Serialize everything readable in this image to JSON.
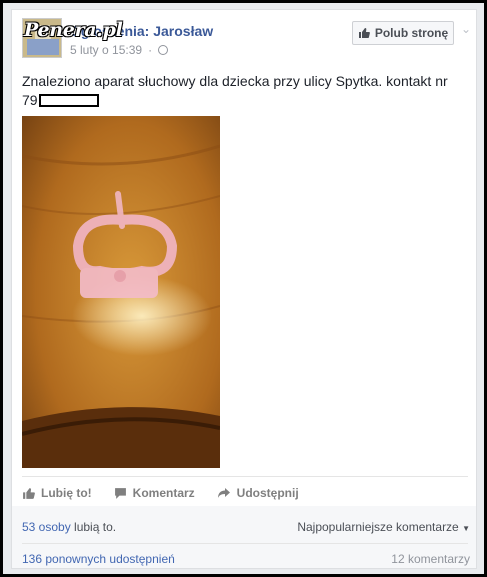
{
  "watermark": "Penera.pl",
  "post": {
    "page_name": "Ogłoszenia: Jarosław",
    "timestamp": "5 luty o 15:39",
    "privacy_icon": "globe-icon",
    "like_page_label": "Polub stronę",
    "text_main": "Znaleziono aparat słuchowy dla dziecka przy ulicy Spytka. kontakt nr",
    "text_phone_prefix": "79"
  },
  "actions": {
    "like": "Lubię to!",
    "comment": "Komentarz",
    "share": "Udostępnij"
  },
  "footer": {
    "likes_count": "53 osoby",
    "likes_suffix": "lubią to.",
    "sort_comments": "Najpopularniejsze komentarze",
    "shares": "136 ponownych udostępnień",
    "comments_count": "12 komentarzy"
  },
  "colors": {
    "link": "#3b5998",
    "action_text": "#7f7f7f",
    "background": "#e9ebee"
  }
}
